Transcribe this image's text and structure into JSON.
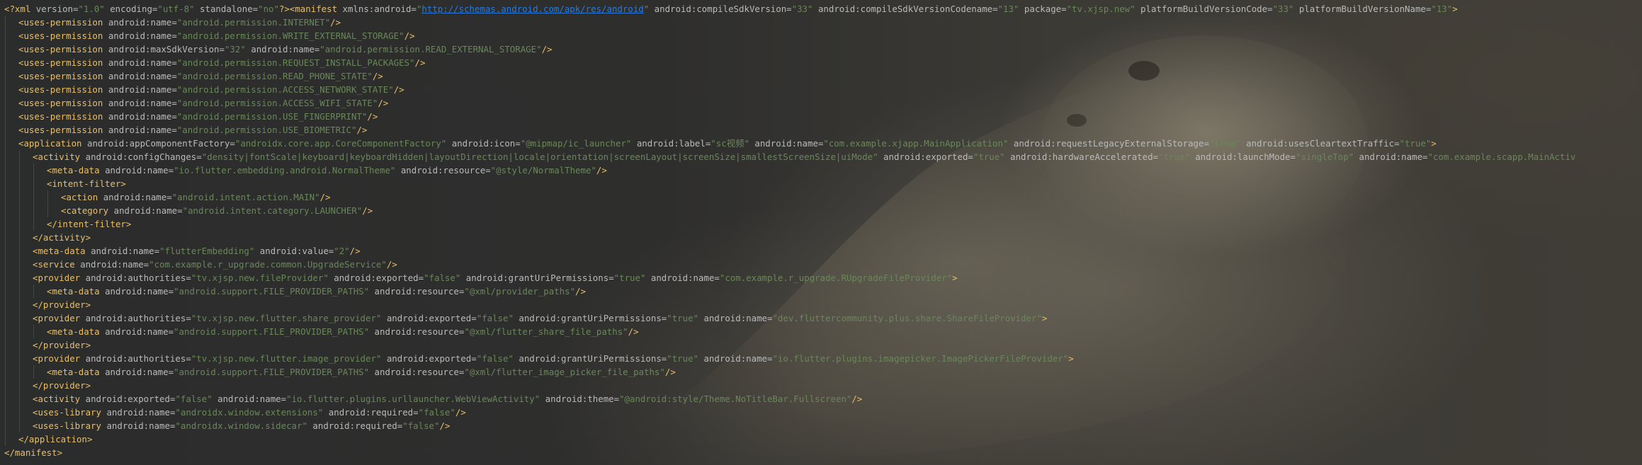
{
  "colors": {
    "background": "#2b2b2b",
    "tag": "#e8bf6a",
    "attribute": "#bababa",
    "value": "#6a8759",
    "url": "#287bde"
  },
  "lines": [
    {
      "indent": 0,
      "parts": [
        [
          "pi",
          "<?xml "
        ],
        [
          "attr",
          "version"
        ],
        [
          "eq",
          "="
        ],
        [
          "val",
          "\"1.0\""
        ],
        [
          "attr",
          " encoding"
        ],
        [
          "eq",
          "="
        ],
        [
          "val",
          "\"utf-8\""
        ],
        [
          "attr",
          " standalone"
        ],
        [
          "eq",
          "="
        ],
        [
          "val",
          "\"no\""
        ],
        [
          "pi",
          "?>"
        ],
        [
          "tag",
          "<manifest "
        ],
        [
          "attr",
          "xmlns:android"
        ],
        [
          "eq",
          "="
        ],
        [
          "val",
          "\""
        ],
        [
          "url",
          "http://schemas.android.com/apk/res/android"
        ],
        [
          "val",
          "\""
        ],
        [
          "attr",
          " android:compileSdkVersion"
        ],
        [
          "eq",
          "="
        ],
        [
          "val",
          "\"33\""
        ],
        [
          "attr",
          " android:compileSdkVersionCodename"
        ],
        [
          "eq",
          "="
        ],
        [
          "val",
          "\"13\""
        ],
        [
          "attr",
          " package"
        ],
        [
          "eq",
          "="
        ],
        [
          "val",
          "\"tv.xjsp.new\""
        ],
        [
          "attr",
          " platformBuildVersionCode"
        ],
        [
          "eq",
          "="
        ],
        [
          "val",
          "\"33\""
        ],
        [
          "attr",
          " platformBuildVersionName"
        ],
        [
          "eq",
          "="
        ],
        [
          "val",
          "\"13\""
        ],
        [
          "tag",
          ">"
        ]
      ]
    },
    {
      "indent": 1,
      "parts": [
        [
          "tag",
          "<uses-permission "
        ],
        [
          "attr",
          "android:name"
        ],
        [
          "eq",
          "="
        ],
        [
          "val",
          "\"android.permission.INTERNET\""
        ],
        [
          "tag",
          "/>"
        ]
      ]
    },
    {
      "indent": 1,
      "parts": [
        [
          "tag",
          "<uses-permission "
        ],
        [
          "attr",
          "android:name"
        ],
        [
          "eq",
          "="
        ],
        [
          "val",
          "\"android.permission.WRITE_EXTERNAL_STORAGE\""
        ],
        [
          "tag",
          "/>"
        ]
      ]
    },
    {
      "indent": 1,
      "parts": [
        [
          "tag",
          "<uses-permission "
        ],
        [
          "attr",
          "android:maxSdkVersion"
        ],
        [
          "eq",
          "="
        ],
        [
          "val",
          "\"32\""
        ],
        [
          "attr",
          " android:name"
        ],
        [
          "eq",
          "="
        ],
        [
          "val",
          "\"android.permission.READ_EXTERNAL_STORAGE\""
        ],
        [
          "tag",
          "/>"
        ]
      ]
    },
    {
      "indent": 1,
      "parts": [
        [
          "tag",
          "<uses-permission "
        ],
        [
          "attr",
          "android:name"
        ],
        [
          "eq",
          "="
        ],
        [
          "val",
          "\"android.permission.REQUEST_INSTALL_PACKAGES\""
        ],
        [
          "tag",
          "/>"
        ]
      ]
    },
    {
      "indent": 1,
      "parts": [
        [
          "tag",
          "<uses-permission "
        ],
        [
          "attr",
          "android:name"
        ],
        [
          "eq",
          "="
        ],
        [
          "val",
          "\"android.permission.READ_PHONE_STATE\""
        ],
        [
          "tag",
          "/>"
        ]
      ]
    },
    {
      "indent": 1,
      "parts": [
        [
          "tag",
          "<uses-permission "
        ],
        [
          "attr",
          "android:name"
        ],
        [
          "eq",
          "="
        ],
        [
          "val",
          "\"android.permission.ACCESS_NETWORK_STATE\""
        ],
        [
          "tag",
          "/>"
        ]
      ]
    },
    {
      "indent": 1,
      "parts": [
        [
          "tag",
          "<uses-permission "
        ],
        [
          "attr",
          "android:name"
        ],
        [
          "eq",
          "="
        ],
        [
          "val",
          "\"android.permission.ACCESS_WIFI_STATE\""
        ],
        [
          "tag",
          "/>"
        ]
      ]
    },
    {
      "indent": 1,
      "parts": [
        [
          "tag",
          "<uses-permission "
        ],
        [
          "attr",
          "android:name"
        ],
        [
          "eq",
          "="
        ],
        [
          "val",
          "\"android.permission.USE_FINGERPRINT\""
        ],
        [
          "tag",
          "/>"
        ]
      ]
    },
    {
      "indent": 1,
      "parts": [
        [
          "tag",
          "<uses-permission "
        ],
        [
          "attr",
          "android:name"
        ],
        [
          "eq",
          "="
        ],
        [
          "val",
          "\"android.permission.USE_BIOMETRIC\""
        ],
        [
          "tag",
          "/>"
        ]
      ]
    },
    {
      "indent": 1,
      "parts": [
        [
          "tag",
          "<application "
        ],
        [
          "attr",
          "android:appComponentFactory"
        ],
        [
          "eq",
          "="
        ],
        [
          "val",
          "\"androidx.core.app.CoreComponentFactory\""
        ],
        [
          "attr",
          " android:icon"
        ],
        [
          "eq",
          "="
        ],
        [
          "val",
          "\"@mipmap/ic_launcher\""
        ],
        [
          "attr",
          " android:label"
        ],
        [
          "eq",
          "="
        ],
        [
          "val",
          "\"sc视频\""
        ],
        [
          "attr",
          " android:name"
        ],
        [
          "eq",
          "="
        ],
        [
          "val",
          "\"com.example.xjapp.MainApplication\""
        ],
        [
          "attr",
          " android:requestLegacyExternalStorage"
        ],
        [
          "eq",
          "="
        ],
        [
          "val",
          "\"true\""
        ],
        [
          "attr",
          " android:usesCleartextTraffic"
        ],
        [
          "eq",
          "="
        ],
        [
          "val",
          "\"true\""
        ],
        [
          "tag",
          ">"
        ]
      ]
    },
    {
      "indent": 2,
      "parts": [
        [
          "tag",
          "<activity "
        ],
        [
          "attr",
          "android:configChanges"
        ],
        [
          "eq",
          "="
        ],
        [
          "val",
          "\"density|fontScale|keyboard|keyboardHidden|layoutDirection|locale|orientation|screenLayout|screenSize|smallestScreenSize|uiMode\""
        ],
        [
          "attr",
          " android:exported"
        ],
        [
          "eq",
          "="
        ],
        [
          "val",
          "\"true\""
        ],
        [
          "attr",
          " android:hardwareAccelerated"
        ],
        [
          "eq",
          "="
        ],
        [
          "val",
          "\"true\""
        ],
        [
          "attr",
          " android:launchMode"
        ],
        [
          "eq",
          "="
        ],
        [
          "val",
          "\"singleTop\""
        ],
        [
          "attr",
          " android:name"
        ],
        [
          "eq",
          "="
        ],
        [
          "val",
          "\"com.example.scapp.MainActiv"
        ]
      ]
    },
    {
      "indent": 3,
      "parts": [
        [
          "tag",
          "<meta-data "
        ],
        [
          "attr",
          "android:name"
        ],
        [
          "eq",
          "="
        ],
        [
          "val",
          "\"io.flutter.embedding.android.NormalTheme\""
        ],
        [
          "attr",
          " android:resource"
        ],
        [
          "eq",
          "="
        ],
        [
          "val",
          "\"@style/NormalTheme\""
        ],
        [
          "tag",
          "/>"
        ]
      ]
    },
    {
      "indent": 3,
      "parts": [
        [
          "tag",
          "<intent-filter>"
        ]
      ]
    },
    {
      "indent": 4,
      "parts": [
        [
          "tag",
          "<action "
        ],
        [
          "attr",
          "android:name"
        ],
        [
          "eq",
          "="
        ],
        [
          "val",
          "\"android.intent.action.MAIN\""
        ],
        [
          "tag",
          "/>"
        ]
      ]
    },
    {
      "indent": 4,
      "parts": [
        [
          "tag",
          "<category "
        ],
        [
          "attr",
          "android:name"
        ],
        [
          "eq",
          "="
        ],
        [
          "val",
          "\"android.intent.category.LAUNCHER\""
        ],
        [
          "tag",
          "/>"
        ]
      ]
    },
    {
      "indent": 3,
      "parts": [
        [
          "tag",
          "</intent-filter>"
        ]
      ]
    },
    {
      "indent": 2,
      "parts": [
        [
          "tag",
          "</activity>"
        ]
      ]
    },
    {
      "indent": 2,
      "parts": [
        [
          "tag",
          "<meta-data "
        ],
        [
          "attr",
          "android:name"
        ],
        [
          "eq",
          "="
        ],
        [
          "val",
          "\"flutterEmbedding\""
        ],
        [
          "attr",
          " android:value"
        ],
        [
          "eq",
          "="
        ],
        [
          "val",
          "\"2\""
        ],
        [
          "tag",
          "/>"
        ]
      ]
    },
    {
      "indent": 2,
      "parts": [
        [
          "tag",
          "<service "
        ],
        [
          "attr",
          "android:name"
        ],
        [
          "eq",
          "="
        ],
        [
          "val",
          "\"com.example.r_upgrade.common.UpgradeService\""
        ],
        [
          "tag",
          "/>"
        ]
      ]
    },
    {
      "indent": 2,
      "parts": [
        [
          "tag",
          "<provider "
        ],
        [
          "attr",
          "android:authorities"
        ],
        [
          "eq",
          "="
        ],
        [
          "val",
          "\"tv.xjsp.new.fileProvider\""
        ],
        [
          "attr",
          " android:exported"
        ],
        [
          "eq",
          "="
        ],
        [
          "val",
          "\"false\""
        ],
        [
          "attr",
          " android:grantUriPermissions"
        ],
        [
          "eq",
          "="
        ],
        [
          "val",
          "\"true\""
        ],
        [
          "attr",
          " android:name"
        ],
        [
          "eq",
          "="
        ],
        [
          "val",
          "\"com.example.r_upgrade.RUpgradeFileProvider\""
        ],
        [
          "tag",
          ">"
        ]
      ]
    },
    {
      "indent": 3,
      "parts": [
        [
          "tag",
          "<meta-data "
        ],
        [
          "attr",
          "android:name"
        ],
        [
          "eq",
          "="
        ],
        [
          "val",
          "\"android.support.FILE_PROVIDER_PATHS\""
        ],
        [
          "attr",
          " android:resource"
        ],
        [
          "eq",
          "="
        ],
        [
          "val",
          "\"@xml/provider_paths\""
        ],
        [
          "tag",
          "/>"
        ]
      ]
    },
    {
      "indent": 2,
      "parts": [
        [
          "tag",
          "</provider>"
        ]
      ]
    },
    {
      "indent": 2,
      "parts": [
        [
          "tag",
          "<provider "
        ],
        [
          "attr",
          "android:authorities"
        ],
        [
          "eq",
          "="
        ],
        [
          "val",
          "\"tv.xjsp.new.flutter.share_provider\""
        ],
        [
          "attr",
          " android:exported"
        ],
        [
          "eq",
          "="
        ],
        [
          "val",
          "\"false\""
        ],
        [
          "attr",
          " android:grantUriPermissions"
        ],
        [
          "eq",
          "="
        ],
        [
          "val",
          "\"true\""
        ],
        [
          "attr",
          " android:name"
        ],
        [
          "eq",
          "="
        ],
        [
          "val",
          "\"dev.fluttercommunity.plus.share.ShareFileProvider\""
        ],
        [
          "tag",
          ">"
        ]
      ]
    },
    {
      "indent": 3,
      "parts": [
        [
          "tag",
          "<meta-data "
        ],
        [
          "attr",
          "android:name"
        ],
        [
          "eq",
          "="
        ],
        [
          "val",
          "\"android.support.FILE_PROVIDER_PATHS\""
        ],
        [
          "attr",
          " android:resource"
        ],
        [
          "eq",
          "="
        ],
        [
          "val",
          "\"@xml/flutter_share_file_paths\""
        ],
        [
          "tag",
          "/>"
        ]
      ]
    },
    {
      "indent": 2,
      "parts": [
        [
          "tag",
          "</provider>"
        ]
      ]
    },
    {
      "indent": 2,
      "parts": [
        [
          "tag",
          "<provider "
        ],
        [
          "attr",
          "android:authorities"
        ],
        [
          "eq",
          "="
        ],
        [
          "val",
          "\"tv.xjsp.new.flutter.image_provider\""
        ],
        [
          "attr",
          " android:exported"
        ],
        [
          "eq",
          "="
        ],
        [
          "val",
          "\"false\""
        ],
        [
          "attr",
          " android:grantUriPermissions"
        ],
        [
          "eq",
          "="
        ],
        [
          "val",
          "\"true\""
        ],
        [
          "attr",
          " android:name"
        ],
        [
          "eq",
          "="
        ],
        [
          "val",
          "\"io.flutter.plugins.imagepicker.ImagePickerFileProvider\""
        ],
        [
          "tag",
          ">"
        ]
      ]
    },
    {
      "indent": 3,
      "parts": [
        [
          "tag",
          "<meta-data "
        ],
        [
          "attr",
          "android:name"
        ],
        [
          "eq",
          "="
        ],
        [
          "val",
          "\"android.support.FILE_PROVIDER_PATHS\""
        ],
        [
          "attr",
          " android:resource"
        ],
        [
          "eq",
          "="
        ],
        [
          "val",
          "\"@xml/flutter_image_picker_file_paths\""
        ],
        [
          "tag",
          "/>"
        ]
      ]
    },
    {
      "indent": 2,
      "parts": [
        [
          "tag",
          "</provider>"
        ]
      ]
    },
    {
      "indent": 2,
      "parts": [
        [
          "tag",
          "<activity "
        ],
        [
          "attr",
          "android:exported"
        ],
        [
          "eq",
          "="
        ],
        [
          "val",
          "\"false\""
        ],
        [
          "attr",
          " android:name"
        ],
        [
          "eq",
          "="
        ],
        [
          "val",
          "\"io.flutter.plugins.urllauncher.WebViewActivity\""
        ],
        [
          "attr",
          " android:theme"
        ],
        [
          "eq",
          "="
        ],
        [
          "val",
          "\"@android:style/Theme.NoTitleBar.Fullscreen\""
        ],
        [
          "tag",
          "/>"
        ]
      ]
    },
    {
      "indent": 2,
      "parts": [
        [
          "tag",
          "<uses-library "
        ],
        [
          "attr",
          "android:name"
        ],
        [
          "eq",
          "="
        ],
        [
          "val",
          "\"androidx.window.extensions\""
        ],
        [
          "attr",
          " android:required"
        ],
        [
          "eq",
          "="
        ],
        [
          "val",
          "\"false\""
        ],
        [
          "tag",
          "/>"
        ]
      ]
    },
    {
      "indent": 2,
      "parts": [
        [
          "tag",
          "<uses-library "
        ],
        [
          "attr",
          "android:name"
        ],
        [
          "eq",
          "="
        ],
        [
          "val",
          "\"androidx.window.sidecar\""
        ],
        [
          "attr",
          " android:required"
        ],
        [
          "eq",
          "="
        ],
        [
          "val",
          "\"false\""
        ],
        [
          "tag",
          "/>"
        ]
      ]
    },
    {
      "indent": 1,
      "parts": [
        [
          "tag",
          "</application>"
        ]
      ]
    },
    {
      "indent": 0,
      "parts": [
        [
          "tag",
          "</manifest>"
        ]
      ]
    }
  ]
}
